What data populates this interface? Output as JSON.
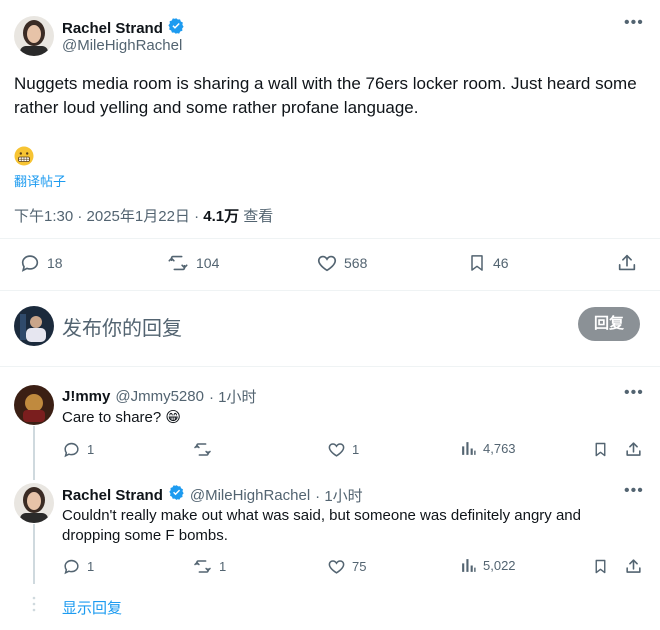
{
  "tweet": {
    "author_name": "Rachel Strand",
    "author_handle": "@MileHighRachel",
    "text": "Nuggets media room is sharing a wall with the 76ers locker room. Just heard some rather loud yelling and some rather profane language.",
    "emoji": "😬",
    "translate_label": "翻译帖子",
    "timestamp": "下午1:30 · 2025年1月22日 · ",
    "views_count": "4.1万",
    "views_label": " 查看",
    "stats": {
      "replies": "18",
      "reposts": "104",
      "likes": "568",
      "bookmarks": "46"
    }
  },
  "compose": {
    "placeholder": "发布你的回复",
    "button_label": "回复"
  },
  "replies": [
    {
      "author_name": "J!mmy",
      "author_handle": "@Jmmy5280",
      "time": "· 1小时",
      "text": "Care to share? 😁",
      "stats": {
        "replies": "1",
        "reposts": "",
        "likes": "1",
        "views": "4,763"
      }
    },
    {
      "author_name": "Rachel Strand",
      "author_handle": "@MileHighRachel",
      "time": "· 1小时",
      "text": "Couldn't really make out what was said, but someone was definitely angry and dropping some F bombs.",
      "stats": {
        "replies": "1",
        "reposts": "1",
        "likes": "75",
        "views": "5,022"
      }
    }
  ],
  "show_replies_label": "显示回复",
  "colors": {
    "accent": "#1d9bf0",
    "text": "#0f1419",
    "secondary": "#536471",
    "reply_button": "#8b9196"
  }
}
